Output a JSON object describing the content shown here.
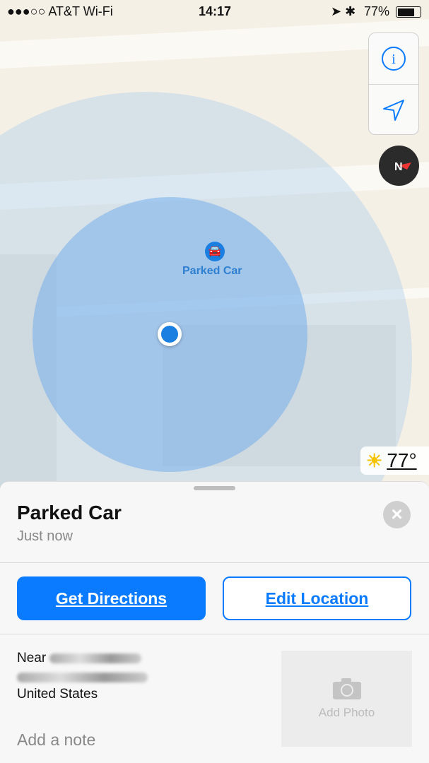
{
  "status": {
    "carrier": "●●●○○ AT&T Wi-Fi",
    "time": "14:17",
    "battery": "77%"
  },
  "map": {
    "pin_label": "Parked Car",
    "accent": "#0a7bff"
  },
  "weather": {
    "temp": "77°",
    "icon": "sun-icon"
  },
  "sheet": {
    "title": "Parked Car",
    "subtitle": "Just now",
    "get_directions": "Get Directions",
    "edit_location": "Edit Location",
    "near": "Near",
    "country": "United States",
    "add_note": "Add a note",
    "add_photo": "Add Photo"
  }
}
